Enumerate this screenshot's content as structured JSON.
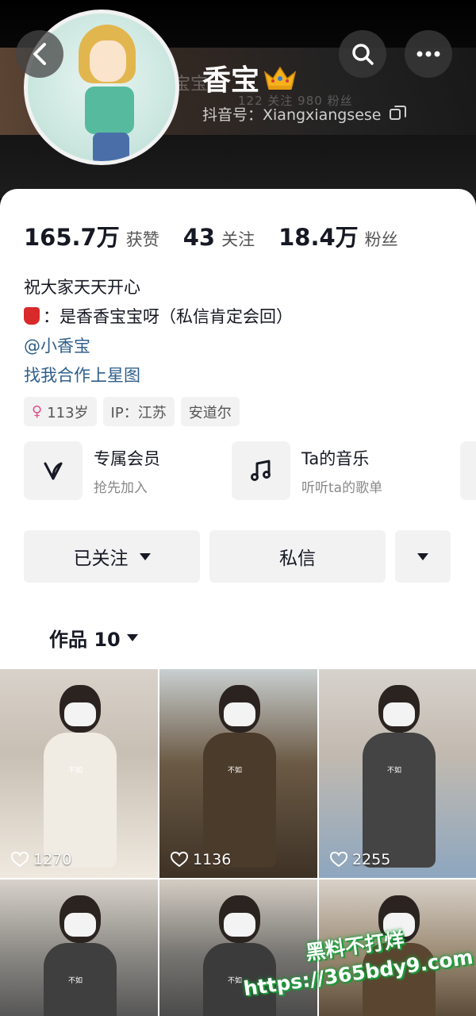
{
  "header": {
    "ghost_name": "宝宝",
    "ghost_stats": "122 关注   980 粉丝",
    "nickname": "香宝",
    "douyin_id": "抖音号：Xiangxiangsese"
  },
  "stats": [
    {
      "num": "165.7万",
      "label": "获赞"
    },
    {
      "num": "43",
      "label": "关注"
    },
    {
      "num": "18.4万",
      "label": "粉丝"
    }
  ],
  "bio": {
    "line1": "祝大家天天开心",
    "line2": "：是香香宝宝呀（私信肯定会回）",
    "mention": "@小香宝",
    "starmap": "找我合作上星图"
  },
  "tags": {
    "age": "113岁",
    "ip": "IP：江苏",
    "city": "安道尔"
  },
  "features": [
    {
      "title": "专属会员",
      "sub": "抢先加入"
    },
    {
      "title": "Ta的音乐",
      "sub": "听听ta的歌单"
    }
  ],
  "actions": {
    "followed": "已关注",
    "message": "私信"
  },
  "works_tab": "作品 10",
  "videos": [
    {
      "likes": "1270",
      "sticker": "不如"
    },
    {
      "likes": "1136",
      "sticker": "不如"
    },
    {
      "likes": "2255",
      "sticker": "不如"
    },
    {
      "likes": "",
      "sticker": "不如"
    },
    {
      "likes": "",
      "sticker": "不如"
    },
    {
      "likes": "",
      "sticker": ""
    }
  ],
  "watermark": {
    "line1": "黑料不打烊",
    "line2": "https://365bdy9.com"
  },
  "colors": {
    "link": "#2f5f8c",
    "text": "#161823",
    "watermark_glow": "#1c9b3a",
    "female": "#e0508a"
  }
}
